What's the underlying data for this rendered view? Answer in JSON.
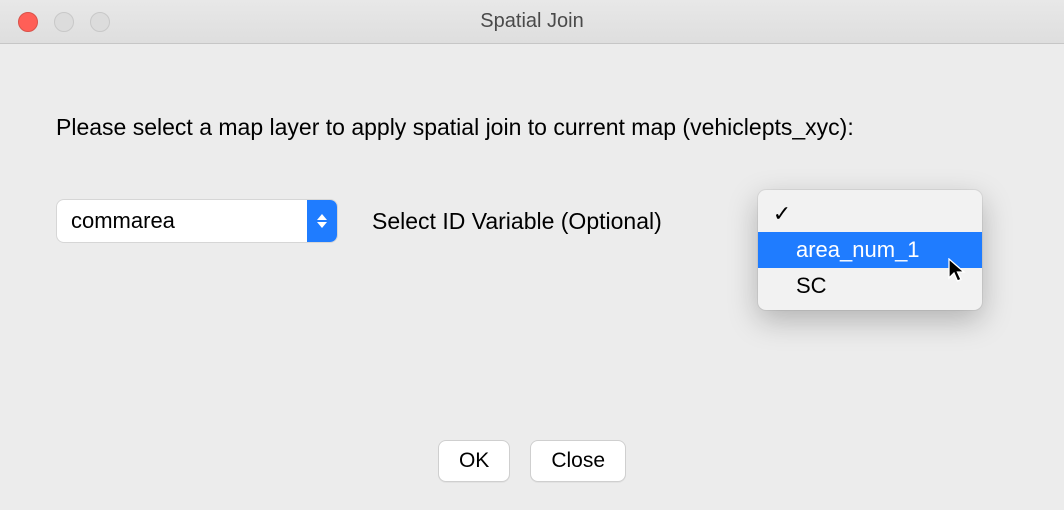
{
  "window": {
    "title": "Spatial Join"
  },
  "instruction": "Please select a map layer to apply spatial join to current map (vehiclepts_xyc):",
  "layer_combo": {
    "selected": "commarea"
  },
  "id_variable": {
    "label": "Select ID Variable (Optional)",
    "selected": "",
    "options": [
      {
        "label": "",
        "checked": true,
        "highlighted": false
      },
      {
        "label": "area_num_1",
        "checked": false,
        "highlighted": true
      },
      {
        "label": "SC",
        "checked": false,
        "highlighted": false
      }
    ]
  },
  "buttons": {
    "ok": "OK",
    "close": "Close"
  }
}
